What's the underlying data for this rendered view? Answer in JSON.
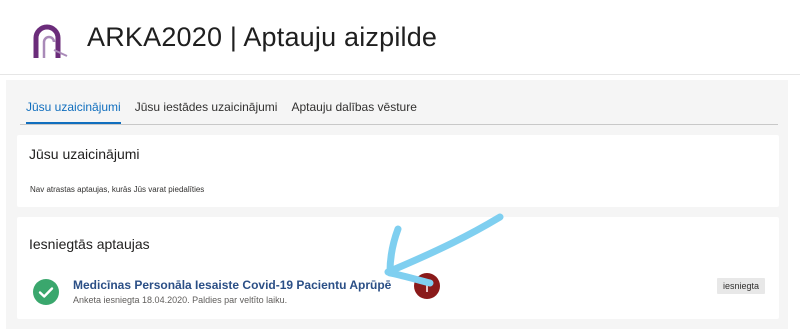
{
  "header": {
    "title": "ARKA2020 | Aptauju aizpilde"
  },
  "tabs": [
    {
      "label": "Jūsu uzaicinājumi",
      "active": true
    },
    {
      "label": "Jūsu iestādes uzaicinājumi",
      "active": false
    },
    {
      "label": "Aptauju dalības vēsture",
      "active": false
    }
  ],
  "invitations": {
    "title": "Jūsu uzaicinājumi",
    "empty_message": "Nav atrastas aptaujas, kurās Jūs varat piedalīties"
  },
  "submitted": {
    "title": "Iesniegtās aptaujas",
    "items": [
      {
        "name": "Medicīnas Personāla Iesaiste Covid-19 Pacientu Aprūpē",
        "subtitle": "Anketa iesniegta 18.04.2020. Paldies par veltīto laiku.",
        "status": "iesniegta",
        "status_icon": "check-circle-icon"
      }
    ]
  },
  "colors": {
    "accent": "#106ebe",
    "logo": "#6b2c7a",
    "success": "#3aa76d",
    "link": "#2b4f86",
    "annotation": "#7fcff0"
  }
}
